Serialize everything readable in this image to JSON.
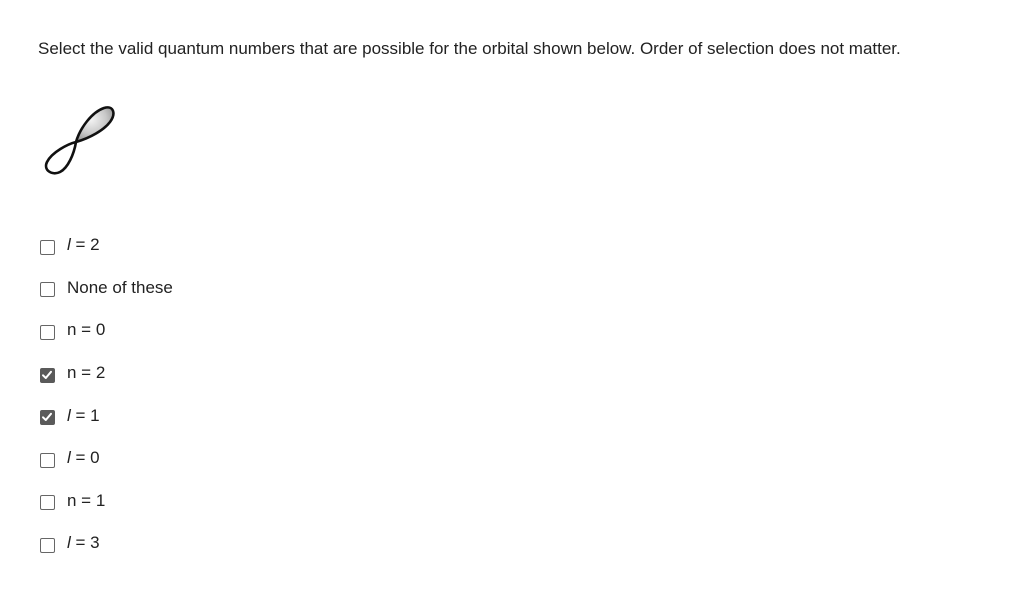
{
  "question": {
    "text": "Select the valid quantum numbers that are possible for the orbital shown below.  Order of selection does not matter."
  },
  "figure": {
    "icon": "p-orbital-icon"
  },
  "options": [
    {
      "var": "l",
      "text": " = 2",
      "checked": false
    },
    {
      "var": "",
      "text": "None of these",
      "checked": false
    },
    {
      "var": "",
      "text": "n = 0",
      "checked": false
    },
    {
      "var": "",
      "text": "n = 2",
      "checked": true
    },
    {
      "var": "l",
      "text": " = 1",
      "checked": true
    },
    {
      "var": "l",
      "text": " = 0",
      "checked": false
    },
    {
      "var": "",
      "text": "n = 1",
      "checked": false
    },
    {
      "var": "l",
      "text": " = 3",
      "checked": false
    }
  ],
  "colors": {
    "checked_fill": "#5a5a5a",
    "box_border": "#666666",
    "text": "#222222"
  }
}
